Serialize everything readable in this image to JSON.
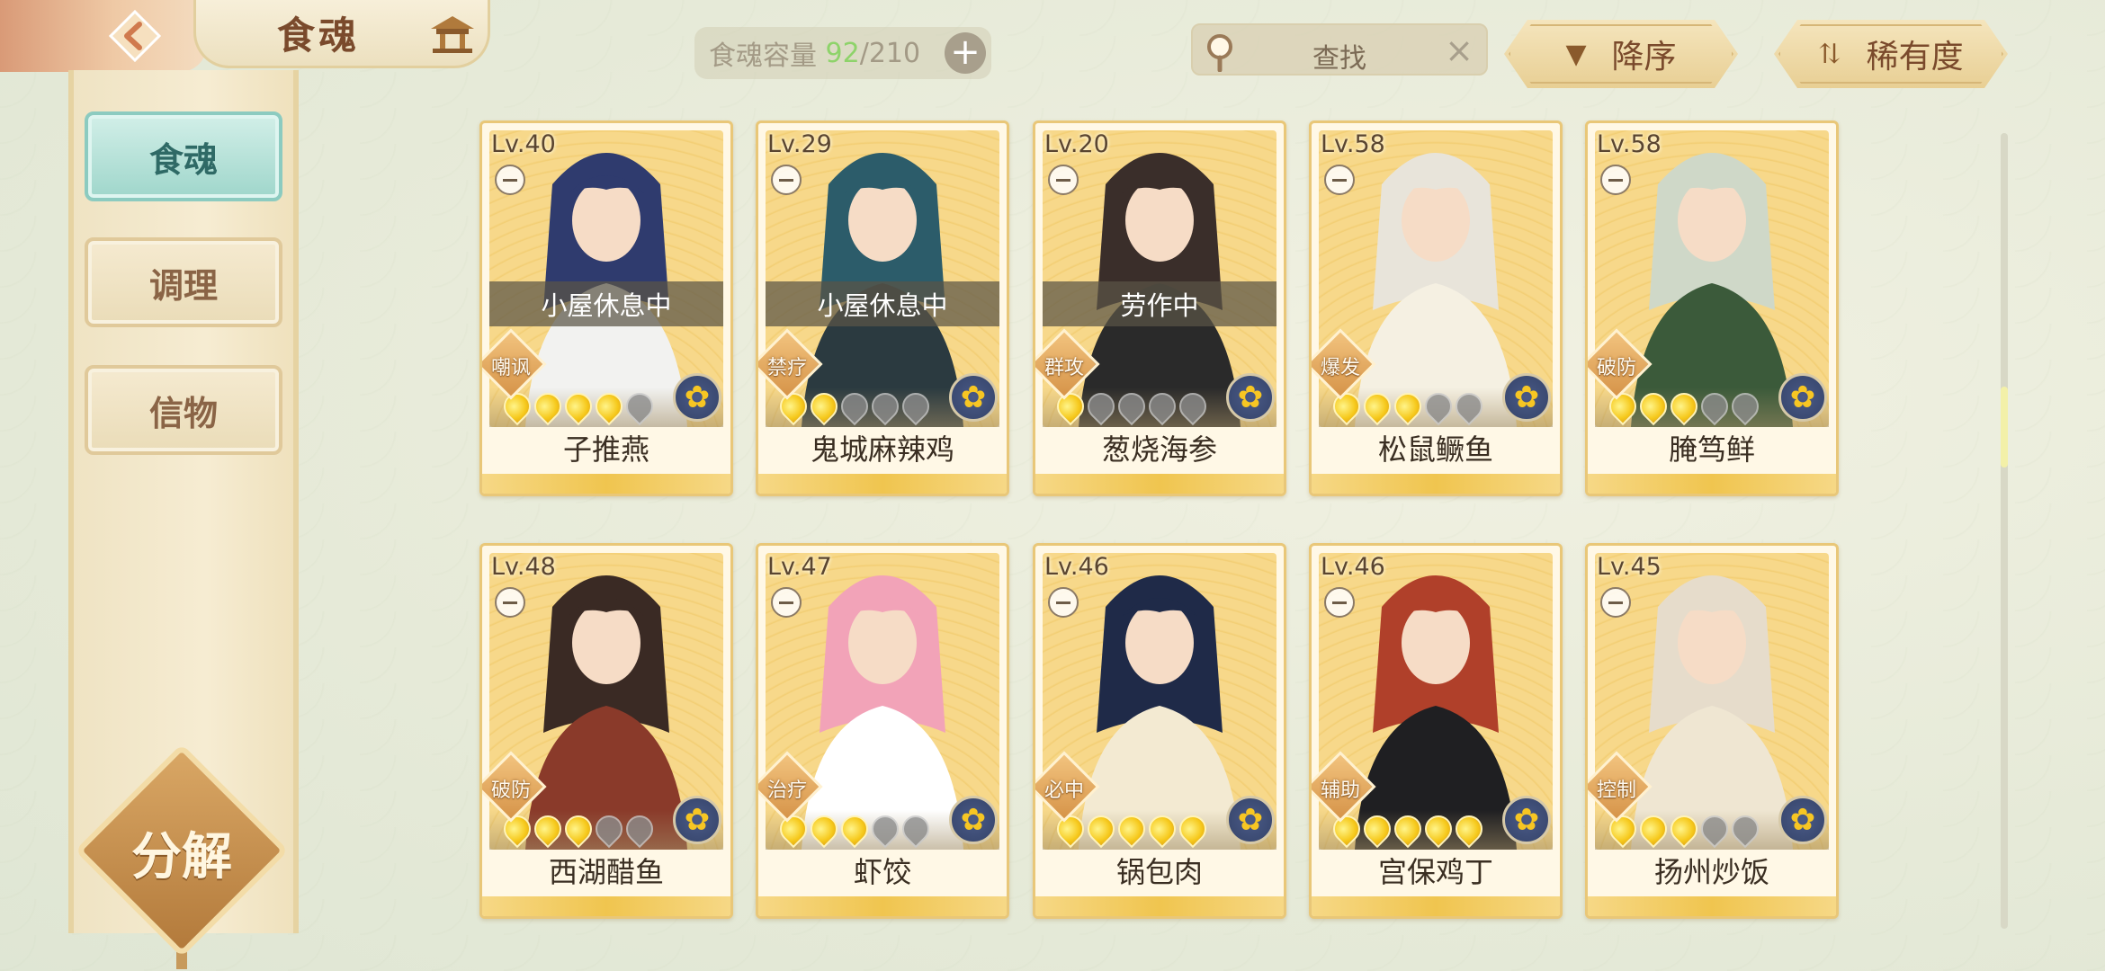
{
  "header": {
    "title": "食魂",
    "capacity_label": "食魂容量",
    "capacity_current": "92",
    "capacity_max": "/210",
    "capacity_add": "+",
    "search_placeholder": "查找",
    "search_clear": "×",
    "sort_order_label": "降序",
    "sort_key_label": "稀有度"
  },
  "sidebar": {
    "tabs": [
      {
        "label": "食魂",
        "active": true
      },
      {
        "label": "调理",
        "active": false
      },
      {
        "label": "信物",
        "active": false
      }
    ],
    "decompose_label": "分解"
  },
  "cards": [
    {
      "level": "Lv.40",
      "status": "小屋休息中",
      "role": "嘲讽",
      "stars": 4,
      "name": "子推燕"
    },
    {
      "level": "Lv.29",
      "status": "小屋休息中",
      "role": "禁疗",
      "stars": 2,
      "name": "鬼城麻辣鸡"
    },
    {
      "level": "Lv.20",
      "status": "劳作中",
      "role": "群攻",
      "stars": 1,
      "name": "葱烧海参"
    },
    {
      "level": "Lv.58",
      "status": "",
      "role": "爆发",
      "stars": 3,
      "name": "松鼠鳜鱼"
    },
    {
      "level": "Lv.58",
      "status": "",
      "role": "破防",
      "stars": 3,
      "name": "腌笃鲜"
    },
    {
      "level": "Lv.48",
      "status": "",
      "role": "破防",
      "stars": 3,
      "name": "西湖醋鱼"
    },
    {
      "level": "Lv.47",
      "status": "",
      "role": "治疗",
      "stars": 3,
      "name": "虾饺"
    },
    {
      "level": "Lv.46",
      "status": "",
      "role": "必中",
      "stars": 5,
      "name": "锅包肉"
    },
    {
      "level": "Lv.46",
      "status": "",
      "role": "辅助",
      "stars": 5,
      "name": "宫保鸡丁"
    },
    {
      "level": "Lv.45",
      "status": "",
      "role": "控制",
      "stars": 3,
      "name": "扬州炒饭"
    }
  ],
  "scroll_position": 0.3,
  "colors": {
    "accent_gold": "#e9c778",
    "active_tab": "#9fd6cb",
    "capacity_current": "#8ed36a",
    "title_brown": "#7a4a2c"
  },
  "icons": {
    "back": "back-arrow-icon",
    "house": "pavilion-icon",
    "search": "search-icon",
    "sort_order": "triangle-down-icon",
    "sort_key": "swap-arrows-icon",
    "fate": "flower-icon"
  }
}
